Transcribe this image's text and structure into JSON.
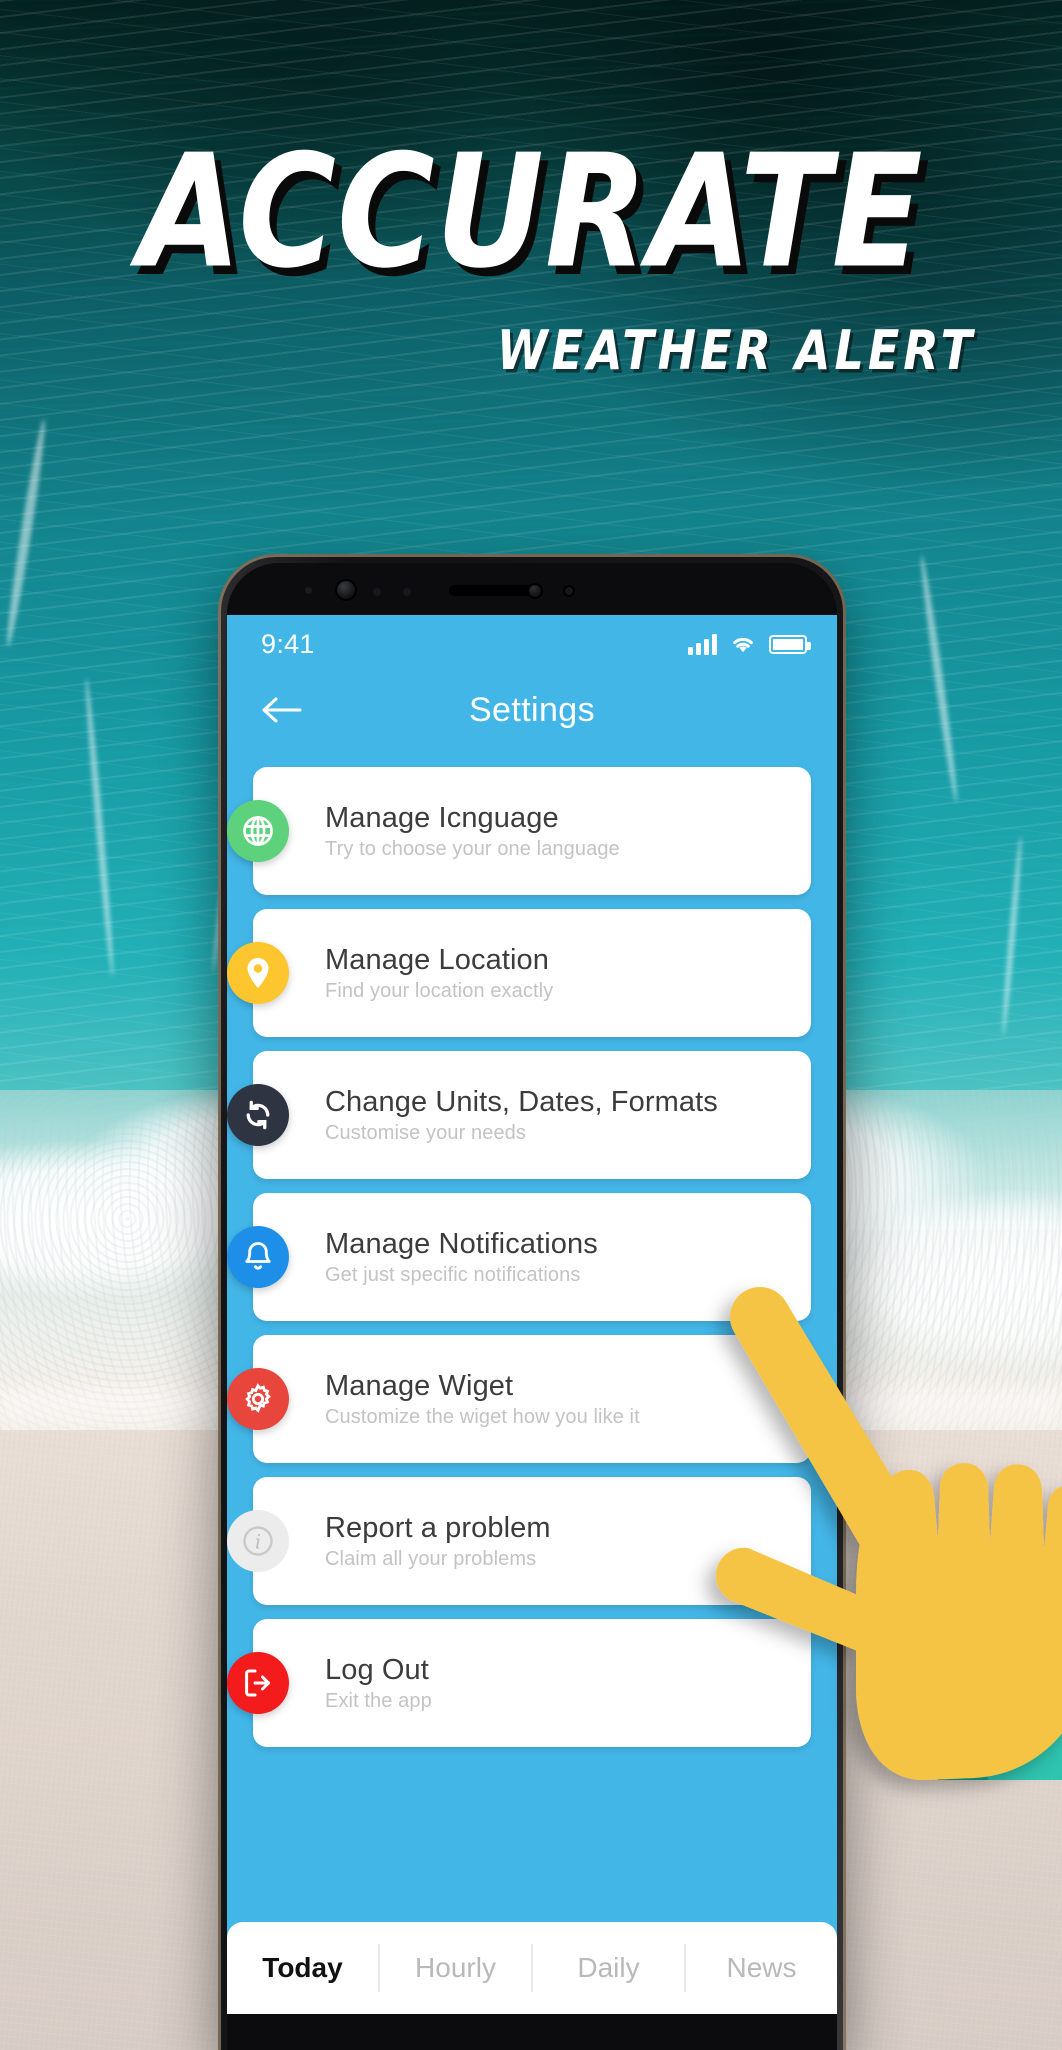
{
  "promo": {
    "headline": "ACCURATE",
    "subheadline": "WEATHER ALERT"
  },
  "phone": {
    "status_bar": {
      "time": "9:41",
      "signal_icon": "signal-bars-icon",
      "wifi_icon": "wifi-icon",
      "battery_icon": "battery-full-icon"
    },
    "app_bar": {
      "back_icon": "back-arrow-icon",
      "title": "Settings"
    },
    "settings_items": [
      {
        "title": "Manage Icnguage",
        "subtitle": "Try to choose your one language",
        "icon": "globe-icon",
        "color": "#5ed17c"
      },
      {
        "title": "Manage Location",
        "subtitle": "Find your location exactly",
        "icon": "map-pin-icon",
        "color": "#fdc62e"
      },
      {
        "title": "Change Units, Dates, Formats",
        "subtitle": "Customise your needs",
        "icon": "refresh-sync-icon",
        "color": "#2e3442"
      },
      {
        "title": "Manage Notifications",
        "subtitle": "Get just specific notifications",
        "icon": "bell-icon",
        "color": "#1e8fe8"
      },
      {
        "title": "Manage Wiget",
        "subtitle": "Customize the wiget how you like it",
        "icon": "gear-icon",
        "color": "#e8453c"
      },
      {
        "title": "Report a problem",
        "subtitle": "Claim all your problems",
        "icon": "info-icon",
        "color": "#ececec"
      },
      {
        "title": "Log Out",
        "subtitle": "Exit the app",
        "icon": "logout-icon",
        "color": "#f31b1b"
      }
    ],
    "tabs": [
      {
        "label": "Today",
        "active": true
      },
      {
        "label": "Hourly",
        "active": false
      },
      {
        "label": "Daily",
        "active": false
      },
      {
        "label": "News",
        "active": false
      }
    ]
  },
  "decor": {
    "hand_cursor_icon": "pointing-hand-cursor",
    "hand_color": "#f6c445",
    "sleeve_color": "#16a394",
    "sleeve_color_light": "#2ec4b0"
  },
  "colors": {
    "screen_bg": "#43b6e8",
    "card_bg": "#ffffff",
    "title_text": "#3c3c3c",
    "subtitle_text": "#c3c3c3"
  }
}
